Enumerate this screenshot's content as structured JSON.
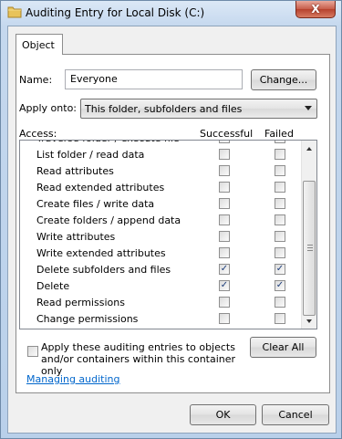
{
  "window": {
    "title": "Auditing Entry for Local Disk (C:)",
    "close_symbol": "X"
  },
  "tabs": [
    {
      "label": "Object"
    }
  ],
  "name": {
    "label": "Name:",
    "value": "Everyone",
    "change_label": "Change..."
  },
  "apply_onto": {
    "label": "Apply onto:",
    "selected": "This folder, subfolders and files"
  },
  "access": {
    "label": "Access:",
    "col_successful": "Successful",
    "col_failed": "Failed",
    "rows": [
      {
        "label": "Traverse folder / execute file",
        "successful": false,
        "failed": false
      },
      {
        "label": "List folder / read data",
        "successful": false,
        "failed": false
      },
      {
        "label": "Read attributes",
        "successful": false,
        "failed": false
      },
      {
        "label": "Read extended attributes",
        "successful": false,
        "failed": false
      },
      {
        "label": "Create files / write data",
        "successful": false,
        "failed": false
      },
      {
        "label": "Create folders / append data",
        "successful": false,
        "failed": false
      },
      {
        "label": "Write attributes",
        "successful": false,
        "failed": false
      },
      {
        "label": "Write extended attributes",
        "successful": false,
        "failed": false
      },
      {
        "label": "Delete subfolders and files",
        "successful": true,
        "failed": true
      },
      {
        "label": "Delete",
        "successful": true,
        "failed": true
      },
      {
        "label": "Read permissions",
        "successful": false,
        "failed": false
      },
      {
        "label": "Change permissions",
        "successful": false,
        "failed": false
      }
    ]
  },
  "apply_entries": {
    "label": "Apply these auditing entries to objects and/or containers within this container only",
    "checked": false
  },
  "clear_all_label": "Clear All",
  "managing_link": "Managing auditing",
  "ok_label": "OK",
  "cancel_label": "Cancel",
  "check_mark": "✓",
  "colors": {
    "link": "#0066cc",
    "close": "#c75d4a"
  }
}
